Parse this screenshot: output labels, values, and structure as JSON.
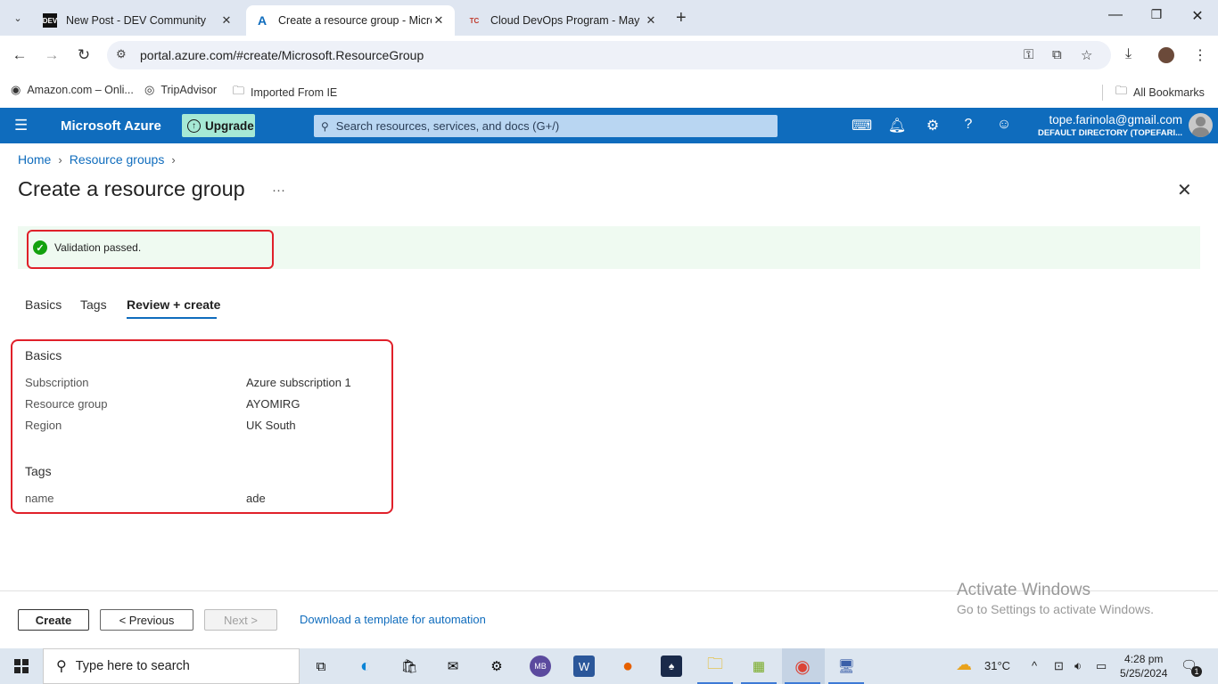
{
  "browser": {
    "tabs": [
      {
        "label": "New Post - DEV Community",
        "favicon": "DEV"
      },
      {
        "label": "Create a resource group - Micro",
        "favicon": "A"
      },
      {
        "label": "Cloud DevOps Program - May",
        "favicon": "TC"
      }
    ],
    "url": "portal.azure.com/#create/Microsoft.ResourceGroup",
    "bookmarks": [
      "Amazon.com – Onli...",
      "TripAdvisor",
      "Imported From IE"
    ],
    "all_bookmarks": "All Bookmarks"
  },
  "azure": {
    "brand": "Microsoft Azure",
    "upgrade_label": "Upgrade",
    "search_placeholder": "Search resources, services, and docs (G+/)",
    "account_email": "tope.farinola@gmail.com",
    "account_directory": "DEFAULT DIRECTORY (TOPEFARI..."
  },
  "page": {
    "breadcrumb": [
      "Home",
      "Resource groups"
    ],
    "title": "Create a resource group",
    "validation": "Validation passed.",
    "tabs": [
      "Basics",
      "Tags",
      "Review + create"
    ],
    "basics_heading": "Basics",
    "basics": [
      {
        "label": "Subscription",
        "value": "Azure subscription 1"
      },
      {
        "label": "Resource group",
        "value": "AYOMIRG"
      },
      {
        "label": "Region",
        "value": "UK South"
      }
    ],
    "tags_heading": "Tags",
    "tags": [
      {
        "label": "name",
        "value": "ade"
      }
    ]
  },
  "footer": {
    "create": "Create",
    "previous": "< Previous",
    "next": "Next >",
    "download": "Download a template for automation"
  },
  "watermark": {
    "line1": "Activate Windows",
    "line2": "Go to Settings to activate Windows."
  },
  "taskbar": {
    "search_placeholder": "Type here to search",
    "temperature": "31°C",
    "time": "4:28 pm",
    "date": "5/25/2024",
    "notification_count": "1"
  },
  "colors": {
    "azure_blue": "#0f6cbd",
    "success_green": "#13a10e",
    "highlight_red": "#e0202a"
  }
}
